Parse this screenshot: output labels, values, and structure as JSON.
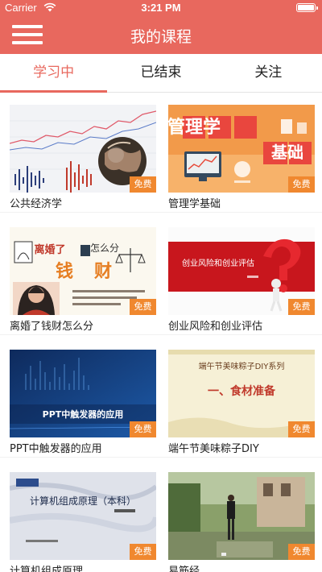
{
  "status_bar": {
    "carrier": "Carrier",
    "time": "3:21 PM",
    "wifi_icon": "wifi-icon",
    "battery_icon": "battery-icon"
  },
  "header": {
    "menu_icon": "hamburger-menu-icon",
    "title": "我的课程",
    "background": "#e8685e"
  },
  "tabs": [
    {
      "label": "学习中",
      "active": true
    },
    {
      "label": "已结束",
      "active": false
    },
    {
      "label": "关注",
      "active": false
    }
  ],
  "colors": {
    "accent": "#e8685e",
    "badge": "#f0882f"
  },
  "courses": [
    {
      "title": "公共经济学",
      "badge": "免费"
    },
    {
      "title": "管理学基础",
      "badge": "免费",
      "thumb_text_1": "管理学",
      "thumb_text_2": "基础"
    },
    {
      "title": "离婚了钱财怎么分",
      "badge": "免费",
      "thumb_text_1": "离婚了",
      "thumb_text_2": "怎么分",
      "thumb_text_3": "钱",
      "thumb_text_4": "财"
    },
    {
      "title": "创业风险和创业评估",
      "badge": "免费",
      "thumb_text_1": "创业风险和创业评估"
    },
    {
      "title": "PPT中触发器的应用",
      "badge": "免费",
      "thumb_text_1": "PPT中触发器的应用"
    },
    {
      "title": "端午节美味粽子DIY",
      "badge": "免费",
      "thumb_text_1": "端午节美味粽子DIY系列",
      "thumb_text_2": "一、食材准备"
    },
    {
      "title": "计算机组成原理",
      "badge": "免费",
      "thumb_text_1": "计算机组成原理（本科）"
    },
    {
      "title": "易筋经",
      "badge": "免费"
    }
  ]
}
